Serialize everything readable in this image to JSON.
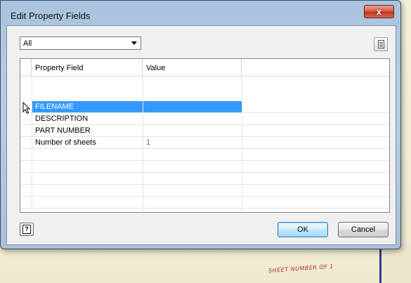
{
  "dialog": {
    "title": "Edit Property Fields",
    "close_glyph": "x"
  },
  "filter": {
    "selected": "All"
  },
  "grid": {
    "columns": [
      "Property Field",
      "Value"
    ],
    "rows": [
      {
        "field": "FILENAME",
        "value": "",
        "selected": true
      },
      {
        "field": "DESCRIPTION",
        "value": "",
        "selected": false
      },
      {
        "field": "PART NUMBER",
        "value": "",
        "selected": false
      },
      {
        "field": "Number of sheets",
        "value": "1",
        "selected": false
      }
    ]
  },
  "buttons": {
    "help_glyph": "?",
    "ok": "OK",
    "cancel": "Cancel"
  },
  "background": {
    "sheet_text": "SHEET NUMBER   OF 1"
  },
  "colors": {
    "selection": "#3399ff",
    "close_button": "#c0321e",
    "window_frame": "#aac0d8"
  },
  "icons": {
    "toolbar": "document-icon",
    "help": "help-icon",
    "pointer": "mouse-cursor-icon"
  }
}
